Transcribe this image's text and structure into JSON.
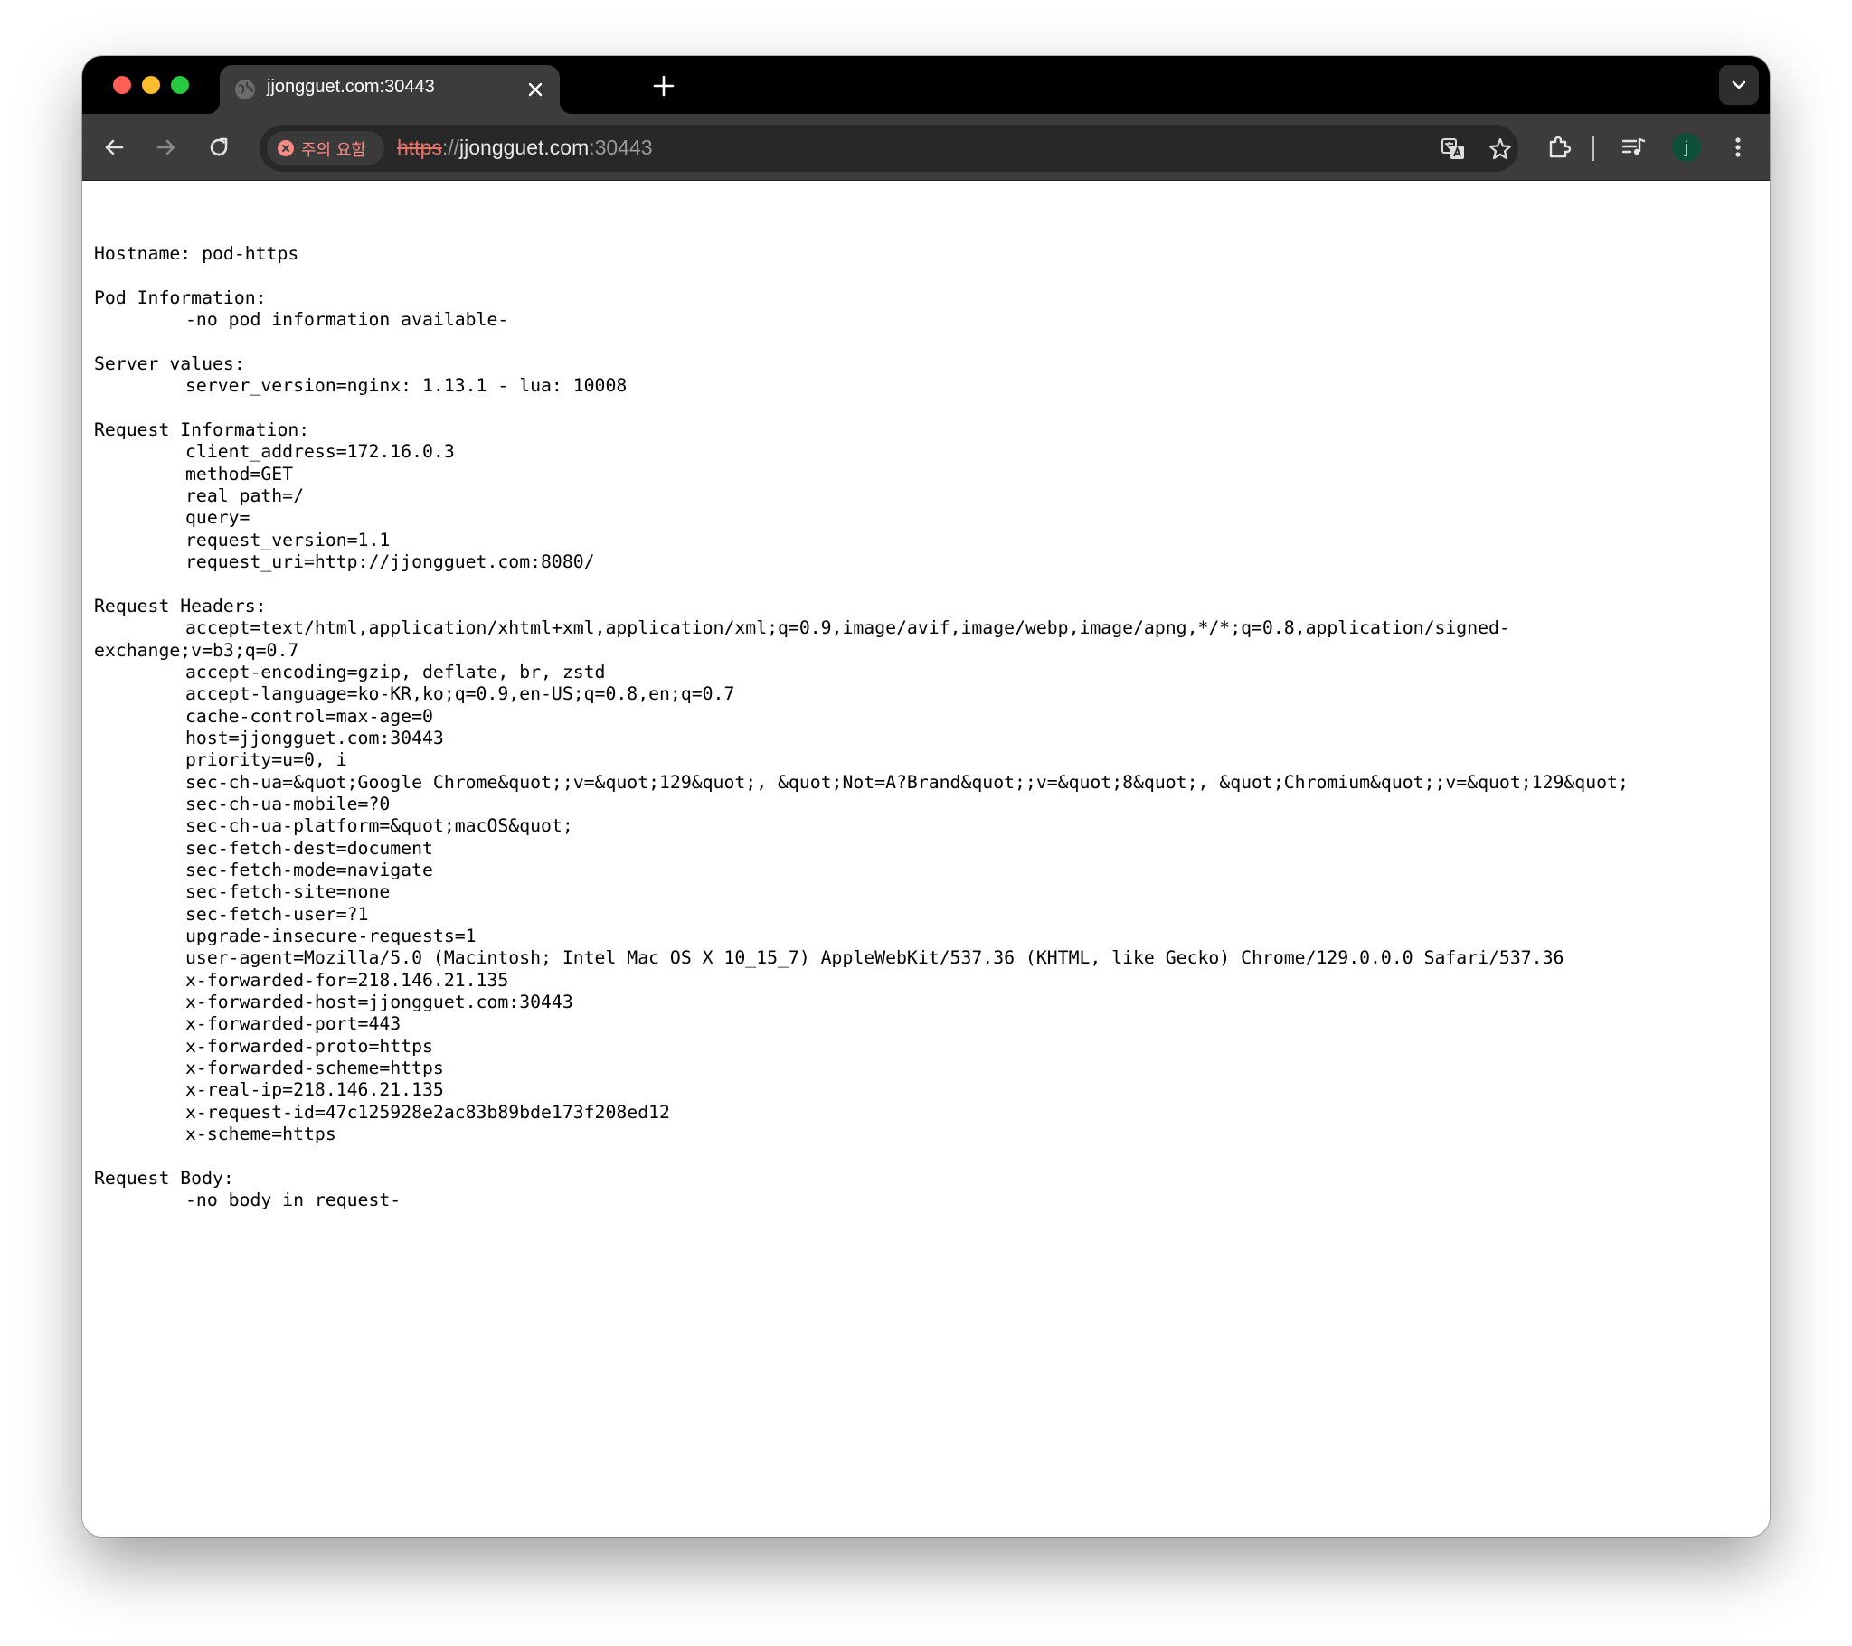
{
  "tab": {
    "title": "jjongguet.com:30443"
  },
  "omnibox": {
    "security_chip": "주의 요함",
    "url_scheme": "https",
    "url_sep": "://",
    "url_host": "jjongguet.com",
    "url_port": ":30443"
  },
  "profile": {
    "initial": "j"
  },
  "colors": {
    "not_secure": "#e57368",
    "avatar_bg": "#0d4f3a"
  },
  "icons": {
    "back": "arrow-left",
    "forward": "arrow-right",
    "reload": "reload",
    "translate": "translate",
    "bookmark": "star",
    "extensions": "puzzle",
    "media": "media-controls",
    "menu": "kebab-vertical"
  },
  "page": {
    "lines": [
      "",
      "Hostname: pod-https",
      "",
      "Pod Information:",
      "\t-no pod information available-",
      "",
      "Server values:",
      "\tserver_version=nginx: 1.13.1 - lua: 10008",
      "",
      "Request Information:",
      "\tclient_address=172.16.0.3",
      "\tmethod=GET",
      "\treal path=/",
      "\tquery=",
      "\trequest_version=1.1",
      "\trequest_uri=http://jjongguet.com:8080/",
      "",
      "Request Headers:",
      "\taccept=text/html,application/xhtml+xml,application/xml;q=0.9,image/avif,image/webp,image/apng,*/*;q=0.8,application/signed-",
      "exchange;v=b3;q=0.7",
      "\taccept-encoding=gzip, deflate, br, zstd",
      "\taccept-language=ko-KR,ko;q=0.9,en-US;q=0.8,en;q=0.7",
      "\tcache-control=max-age=0",
      "\thost=jjongguet.com:30443",
      "\tpriority=u=0, i",
      "\tsec-ch-ua=&quot;Google Chrome&quot;;v=&quot;129&quot;, &quot;Not=A?Brand&quot;;v=&quot;8&quot;, &quot;Chromium&quot;;v=&quot;129&quot;",
      "\tsec-ch-ua-mobile=?0",
      "\tsec-ch-ua-platform=&quot;macOS&quot;",
      "\tsec-fetch-dest=document",
      "\tsec-fetch-mode=navigate",
      "\tsec-fetch-site=none",
      "\tsec-fetch-user=?1",
      "\tupgrade-insecure-requests=1",
      "\tuser-agent=Mozilla/5.0 (Macintosh; Intel Mac OS X 10_15_7) AppleWebKit/537.36 (KHTML, like Gecko) Chrome/129.0.0.0 Safari/537.36",
      "\tx-forwarded-for=218.146.21.135",
      "\tx-forwarded-host=jjongguet.com:30443",
      "\tx-forwarded-port=443",
      "\tx-forwarded-proto=https",
      "\tx-forwarded-scheme=https",
      "\tx-real-ip=218.146.21.135",
      "\tx-request-id=47c125928e2ac83b89bde173f208ed12",
      "\tx-scheme=https",
      "",
      "Request Body:",
      "\t-no body in request-"
    ]
  }
}
